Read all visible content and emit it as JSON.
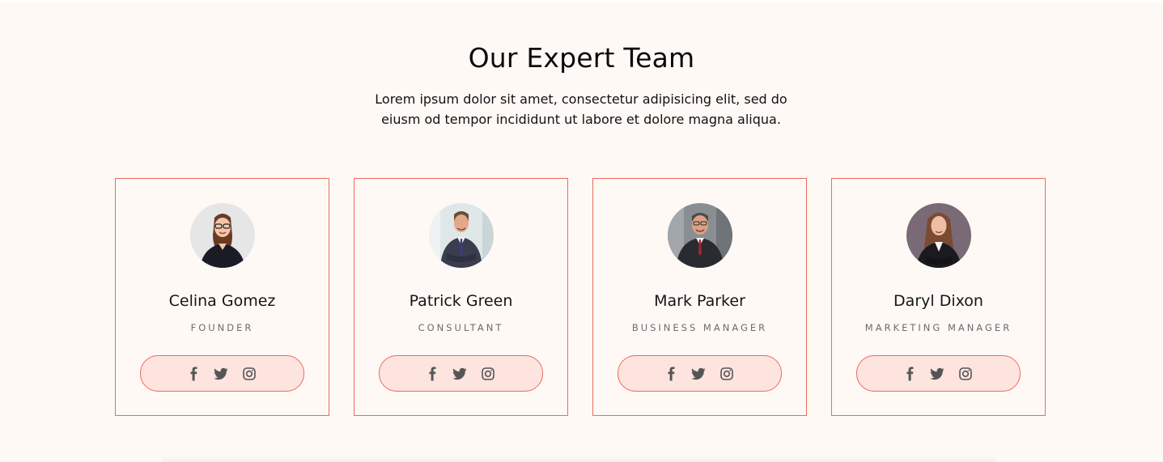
{
  "section": {
    "title": "Our Expert Team",
    "description_line1": "Lorem ipsum dolor sit amet, consectetur adipisicing elit, sed do",
    "description_line2": "eiusm od tempor incididunt ut labore et dolore magna aliqua."
  },
  "members": [
    {
      "name": "Celina Gomez",
      "role": "FOUNDER",
      "photo": "woman-glasses-avatar"
    },
    {
      "name": "Patrick Green",
      "role": "CONSULTANT",
      "photo": "man-suit-avatar"
    },
    {
      "name": "Mark Parker",
      "role": "BUSINESS MANAGER",
      "photo": "older-man-suit-avatar"
    },
    {
      "name": "Daryl Dixon",
      "role": "MARKETING MANAGER",
      "photo": "woman-blazer-avatar"
    }
  ],
  "social_icons": [
    "facebook-icon",
    "twitter-icon",
    "instagram-icon"
  ],
  "colors": {
    "accent": "#ee6a5c",
    "social_bg": "#fde4df",
    "page_bg": "#fff9f6"
  }
}
